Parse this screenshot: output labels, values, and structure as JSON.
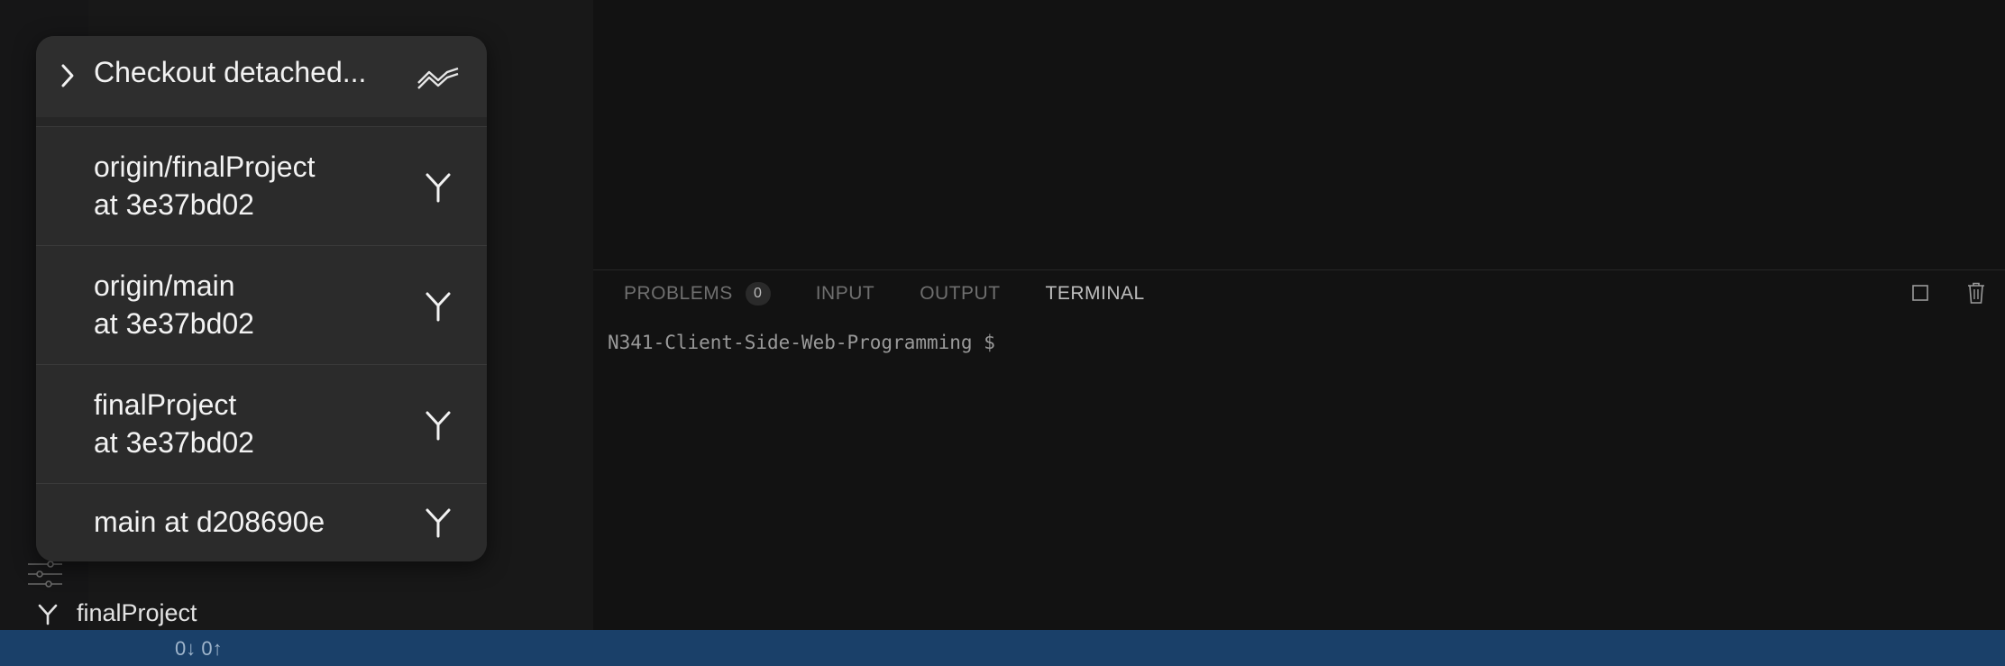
{
  "popup": {
    "header_label": "Checkout detached...",
    "header_icon": "graph-icon",
    "items": [
      {
        "line1": "origin/finalProject",
        "line2": "at 3e37bd02"
      },
      {
        "line1": "origin/main",
        "line2": "at 3e37bd02"
      },
      {
        "line1": "finalProject",
        "line2": "at 3e37bd02"
      },
      {
        "line1": "main at d208690e",
        "line2": ""
      }
    ]
  },
  "sidebar": {
    "current_branch": "finalProject"
  },
  "panel": {
    "tabs": [
      {
        "label": "PROBLEMS",
        "badge": "0"
      },
      {
        "label": "INPUT"
      },
      {
        "label": "OUTPUT"
      },
      {
        "label": "TERMINAL"
      }
    ],
    "active_tab": "TERMINAL",
    "terminal_prompt": "N341-Client-Side-Web-Programming $"
  },
  "statusbar": {
    "sync": "0↓ 0↑",
    "color": "#1a4069"
  }
}
